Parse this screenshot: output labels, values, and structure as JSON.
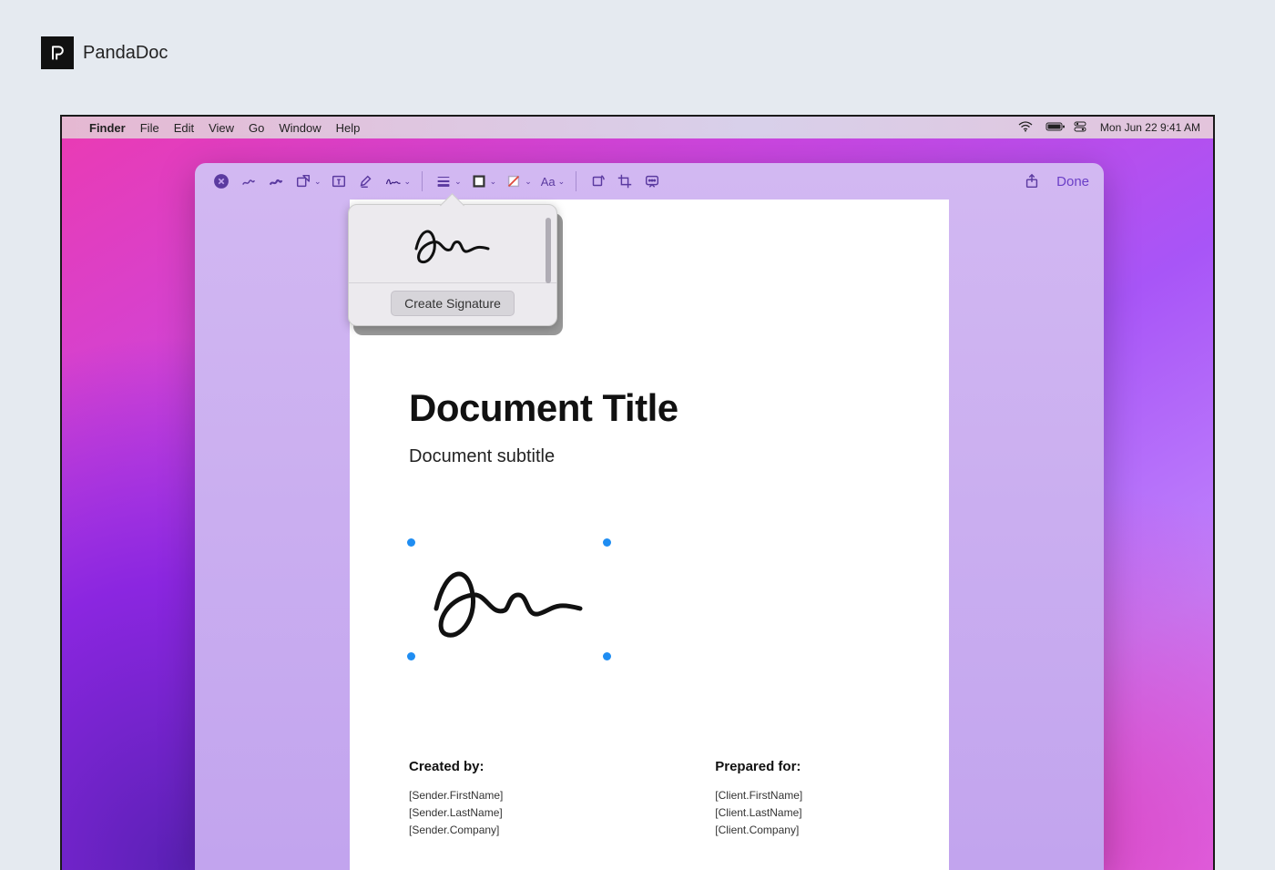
{
  "brand": {
    "name": "PandaDoc",
    "logo_glyph": "ᑭ"
  },
  "menubar": {
    "items": [
      "Finder",
      "File",
      "Edit",
      "View",
      "Go",
      "Window",
      "Help"
    ],
    "datetime": "Mon Jun 22  9:41 AM"
  },
  "toolbar": {
    "done_label": "Done",
    "font_label": "Aa"
  },
  "popover": {
    "create_label": "Create Signature"
  },
  "document": {
    "title": "Document Title",
    "subtitle": "Document subtitle",
    "created": {
      "label": "Created by:",
      "line1": "[Sender.FirstName] [Sender.LastName]",
      "line2": "[Sender.Company]"
    },
    "prepared": {
      "label": "Prepared for:",
      "line1": "[Client.FirstName] [Client.LastName]",
      "line2": "[Client.Company]"
    }
  }
}
